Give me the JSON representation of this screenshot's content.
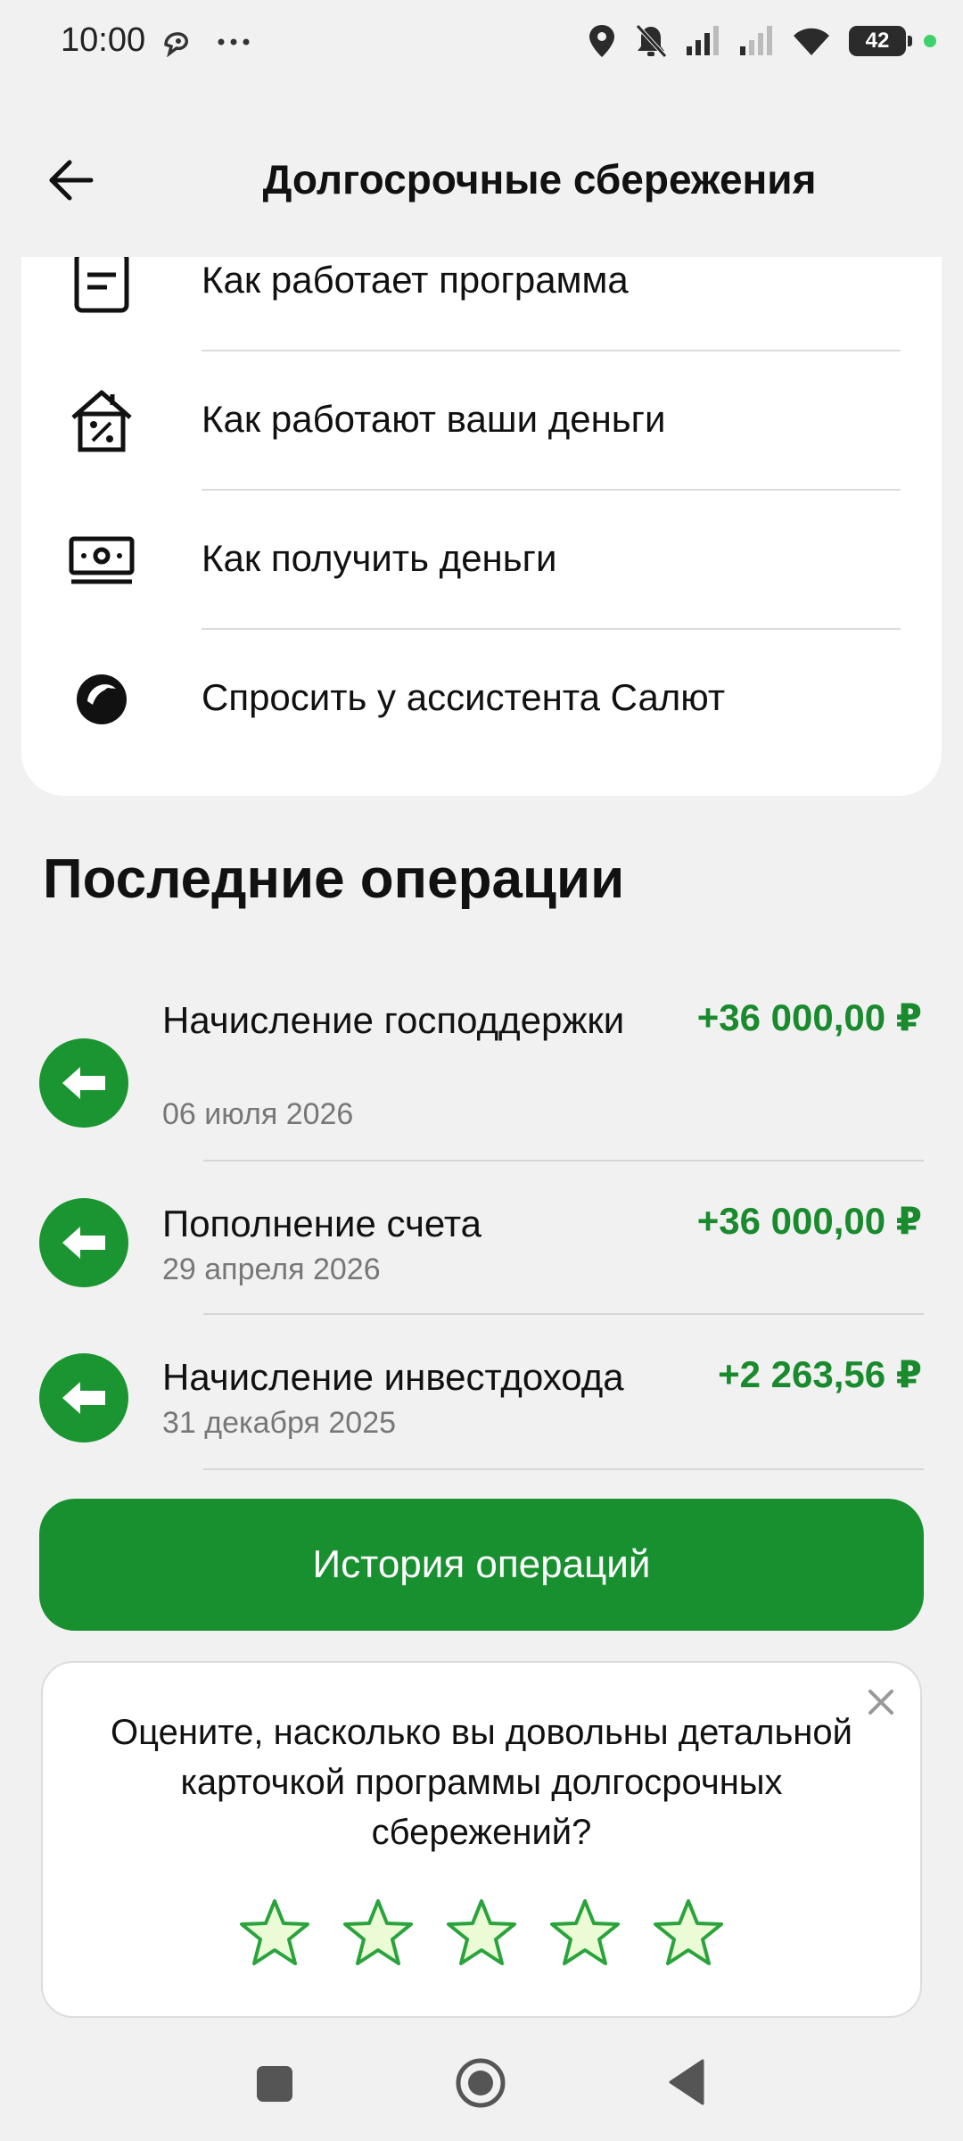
{
  "status_bar": {
    "time": "10:00",
    "battery": "42",
    "icons": [
      "assistant-icon",
      "more-icon",
      "location-icon",
      "bell-off-icon",
      "signal-icon",
      "signal-icon",
      "wifi-icon",
      "battery-icon"
    ]
  },
  "header": {
    "title": "Долгосрочные сбережения",
    "back_icon": "arrow-left-icon"
  },
  "info_list": [
    {
      "label": "Как работает программа",
      "icon": "document-icon"
    },
    {
      "label": "Как работают ваши деньги",
      "icon": "house-percent-icon"
    },
    {
      "label": "Как получить деньги",
      "icon": "banknote-icon"
    },
    {
      "label": "Спросить у ассистента Салют",
      "icon": "salute-icon"
    }
  ],
  "operations": {
    "title": "Последние операции",
    "items": [
      {
        "title": "Начисление господдержки",
        "date": "06 июля 2026",
        "amount": "+36 000,00 ₽"
      },
      {
        "title": "Пополнение счета",
        "date": "29 апреля 2026",
        "amount": "+36 000,00 ₽"
      },
      {
        "title": "Начисление инвестдохода",
        "date": "31 декабря 2025",
        "amount": "+2 263,56 ₽"
      }
    ]
  },
  "history_button": "История операций",
  "rating": {
    "question": "Оцените, насколько вы довольны детальной карточкой программы долгосрочных сбережений?",
    "stars_max": 5,
    "stars_selected": 0
  },
  "colors": {
    "accent": "#189030",
    "amount": "#1a8a2e",
    "background": "#f1f1f1"
  }
}
